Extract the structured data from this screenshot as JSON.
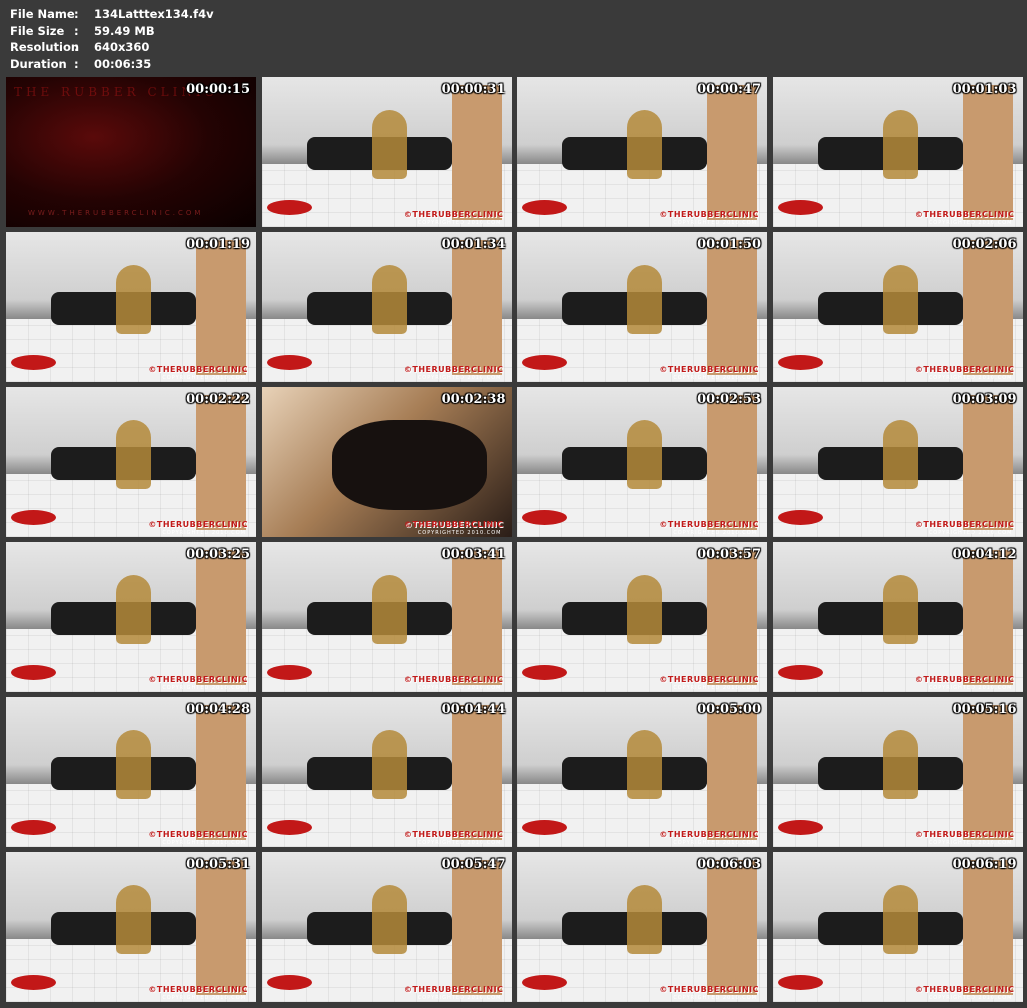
{
  "info": [
    {
      "key": "File Name",
      "sep": ":",
      "value": "134Latttex134.f4v"
    },
    {
      "key": "File Size",
      "sep": ":",
      "value": "59.49 MB"
    },
    {
      "key": "Resolution",
      "sep": ":",
      "value": "640x360"
    },
    {
      "key": "Duration",
      "sep": ":",
      "value": "00:06:35"
    }
  ],
  "intro_brand": "THE RUBBER CLINIC",
  "intro_url": "WWW.THERUBBERCLINIC.COM",
  "watermark": "©THERUBBERCLINIC",
  "watermark_sub": "COPYRIGHTED 2010.COM",
  "thumbnails": [
    {
      "time": "00:00:15",
      "style": "dark"
    },
    {
      "time": "00:00:31",
      "style": "room"
    },
    {
      "time": "00:00:47",
      "style": "room"
    },
    {
      "time": "00:01:03",
      "style": "room"
    },
    {
      "time": "00:01:19",
      "style": "room"
    },
    {
      "time": "00:01:34",
      "style": "room"
    },
    {
      "time": "00:01:50",
      "style": "room"
    },
    {
      "time": "00:02:06",
      "style": "room"
    },
    {
      "time": "00:02:22",
      "style": "room"
    },
    {
      "time": "00:02:38",
      "style": "close"
    },
    {
      "time": "00:02:53",
      "style": "room"
    },
    {
      "time": "00:03:09",
      "style": "room"
    },
    {
      "time": "00:03:25",
      "style": "room"
    },
    {
      "time": "00:03:41",
      "style": "room"
    },
    {
      "time": "00:03:57",
      "style": "room"
    },
    {
      "time": "00:04:12",
      "style": "room"
    },
    {
      "time": "00:04:28",
      "style": "room"
    },
    {
      "time": "00:04:44",
      "style": "room"
    },
    {
      "time": "00:05:00",
      "style": "room"
    },
    {
      "time": "00:05:16",
      "style": "room"
    },
    {
      "time": "00:05:31",
      "style": "room"
    },
    {
      "time": "00:05:47",
      "style": "room"
    },
    {
      "time": "00:06:03",
      "style": "room"
    },
    {
      "time": "00:06:19",
      "style": "room"
    }
  ]
}
